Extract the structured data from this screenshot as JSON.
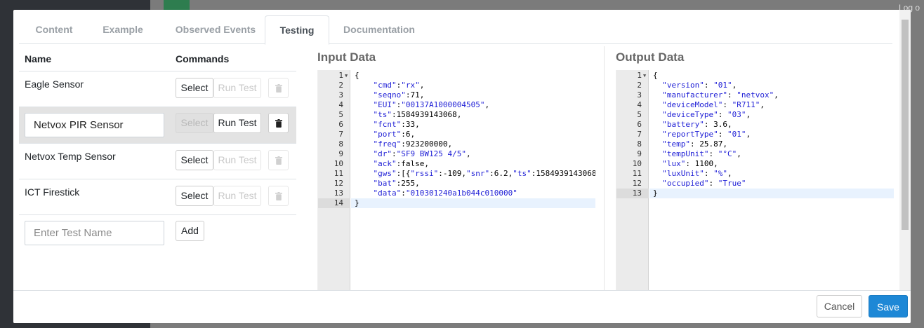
{
  "background": {
    "logout_label": "Log o"
  },
  "tabs": [
    {
      "label": "Content"
    },
    {
      "label": "Example"
    },
    {
      "label": "Observed Events"
    },
    {
      "label": "Testing"
    },
    {
      "label": "Documentation"
    }
  ],
  "tests_table": {
    "name_header": "Name",
    "commands_header": "Commands",
    "select_label": "Select",
    "run_test_label": "Run Test",
    "add_label": "Add",
    "new_test_placeholder": "Enter Test Name",
    "rows": [
      {
        "name": "Eagle Sensor"
      },
      {
        "name": "Netvox PIR Sensor"
      },
      {
        "name": "Netvox Temp Sensor"
      },
      {
        "name": "ICT Firestick"
      }
    ]
  },
  "input_panel": {
    "title": "Input Data",
    "lines": [
      "{",
      "    \"cmd\":\"rx\",",
      "    \"seqno\":71,",
      "    \"EUI\":\"00137A1000004505\",",
      "    \"ts\":1584939143068,",
      "    \"fcnt\":33,",
      "    \"port\":6,",
      "    \"freq\":923200000,",
      "    \"dr\":\"SF9 BW125 4/5\",",
      "    \"ack\":false,",
      "    \"gws\":[{\"rssi\":-109,\"snr\":6.2,\"ts\":1584939143068",
      "    \"bat\":255,",
      "    \"data\":\"010301240a1b044c010000\"",
      "}"
    ]
  },
  "output_panel": {
    "title": "Output Data",
    "lines": [
      "{",
      "  \"version\": \"01\",",
      "  \"manufacturer\": \"netvox\",",
      "  \"deviceModel\": \"R711\",",
      "  \"deviceType\": \"03\",",
      "  \"battery\": 3.6,",
      "  \"reportType\": \"01\",",
      "  \"temp\": 25.87,",
      "  \"tempUnit\": \"°C\",",
      "  \"lux\": 1100,",
      "  \"luxUnit\": \"%\",",
      "  \"occupied\": \"True\"",
      "}"
    ]
  },
  "footer": {
    "cancel_label": "Cancel",
    "save_label": "Save"
  },
  "colors": {
    "primary": "#1e88d6",
    "selected_row": "#e3e3e3"
  },
  "icons": {
    "delete": "trash-icon"
  }
}
